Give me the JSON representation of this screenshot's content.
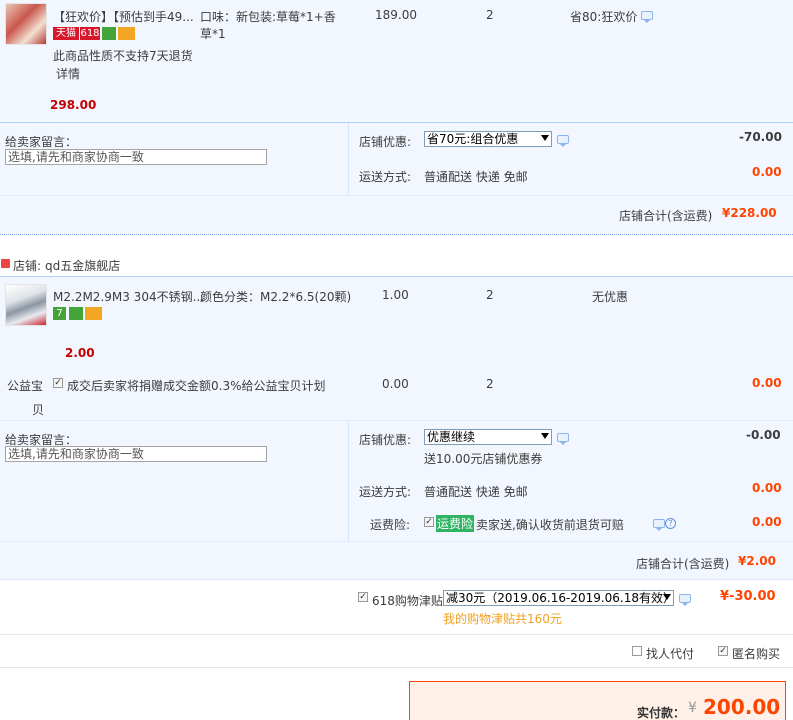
{
  "shop1": {
    "item": {
      "title": "【狂欢价】【预估到手49...",
      "spec": "口味：新包装:草莓*1+香",
      "spec2": "草*1",
      "price": "189.00",
      "qty": "2",
      "promo": "省80:狂欢价",
      "tmall_badge": "天猫",
      "badge_618": "618",
      "no_return": "此商品性质不支持7天退货",
      "detail": "详情",
      "subtotal": "298.00"
    },
    "message_label": "给卖家留言：",
    "message_placeholder": "选填,请先和商家协商一致",
    "discount_label": "店铺优惠:",
    "discount_value": "省70元:组合优惠",
    "discount_amount": "-70.00",
    "shipping_label": "运送方式:",
    "shipping_value": "普通配送 快递 免邮",
    "shipping_amount": "0.00",
    "total_label": "店铺合计(含运费)",
    "total_amount": "¥228.00"
  },
  "shop2": {
    "shop_label": "店铺:",
    "shop_name": "qd五金旗舰店",
    "item": {
      "title": "M2.2M2.9M3 304不锈钢...",
      "spec": "颜色分类：M2.2*6.5(20颗)",
      "price": "1.00",
      "qty": "2",
      "promo": "无优惠",
      "subtotal": "2.00",
      "badge_7": "7"
    },
    "charity": {
      "label1": "公益宝",
      "label2": "贝",
      "text": "成交后卖家将捐赠成交金额0.3%给公益宝贝计划",
      "price": "0.00",
      "qty": "2",
      "amount": "0.00"
    },
    "message_label": "给卖家留言：",
    "message_placeholder": "选填,请先和商家协商一致",
    "discount_label": "店铺优惠:",
    "discount_value": "优惠继续",
    "discount_amount": "-0.00",
    "coupon_note": "送10.00元店铺优惠券",
    "shipping_label": "运送方式:",
    "shipping_value": "普通配送 快递 免邮",
    "shipping_amount": "0.00",
    "insurance_label": "运费险:",
    "insurance_tag": "运费险",
    "insurance_text": "卖家送,确认收货前退货可赔",
    "insurance_amount": "0.00",
    "total_label": "店铺合计(含运费)",
    "total_amount": "¥2.00"
  },
  "allowance": {
    "label": "618购物津贴",
    "select_value": "减30元（2019.06.16-2019.06.18有效）",
    "amount": "¥-30.00",
    "note": "我的购物津贴共160元"
  },
  "options": {
    "proxy_pay": "找人代付",
    "anonymous": "匿名购买"
  },
  "payment": {
    "label": "实付款：",
    "currency": "¥",
    "amount": "200.00"
  },
  "colors": {
    "accent": "#ff4400",
    "band": "#f2f7ff",
    "border": "#b2d1ff",
    "insurance_green": "#2fb464"
  }
}
